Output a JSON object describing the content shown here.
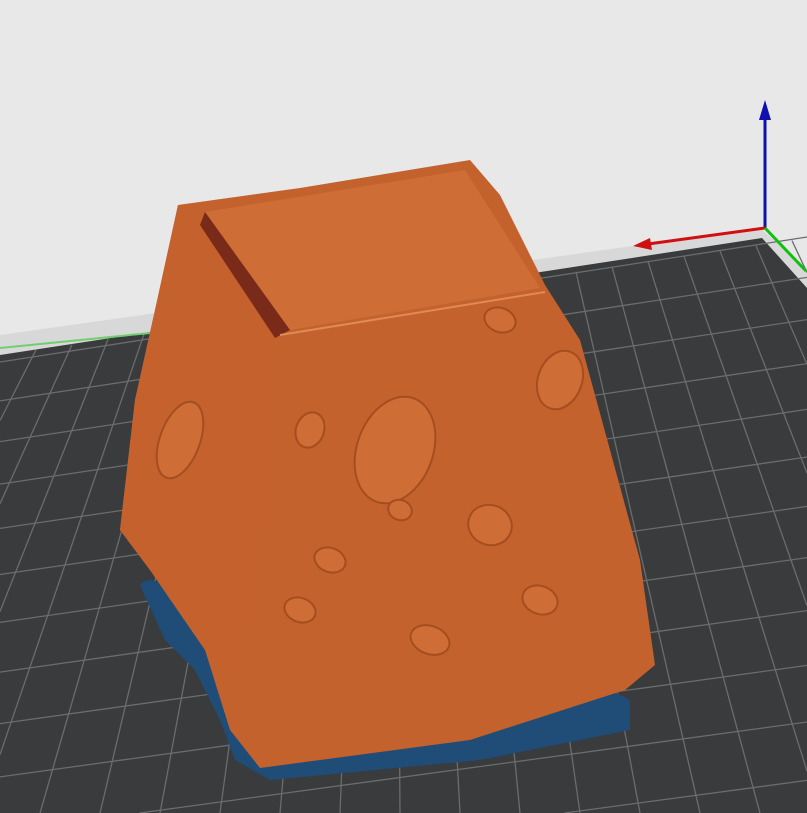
{
  "viewport": {
    "background_color": "#e8e8e8",
    "bed_color": "#393b3c",
    "bed_grid_color": "#6a6c6e",
    "bed_edge_color": "#d8d8d8",
    "model_color": "#c4622d",
    "model_shadow_color": "#a44e20",
    "model_inner_color": "#cf6d36",
    "skirt_color": "#1f4d78",
    "axis_x_color": "#d01010",
    "axis_y_color": "#10c010",
    "axis_z_color": "#1010b0"
  }
}
